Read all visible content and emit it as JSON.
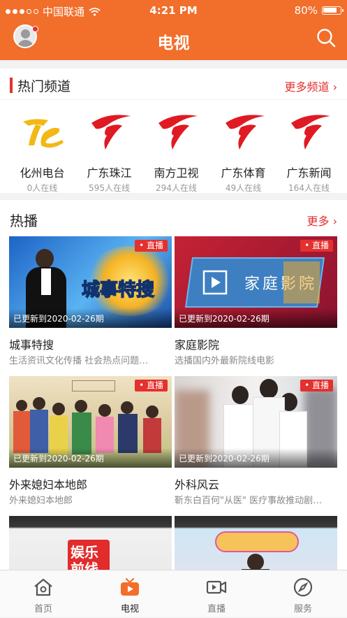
{
  "status_bar": {
    "carrier": "中国联通",
    "time": "4:21 PM",
    "battery": "80%"
  },
  "header": {
    "title": "电视"
  },
  "hot_channels": {
    "title": "热门频道",
    "more": "更多频道",
    "items": [
      {
        "name": "化州电台",
        "online": "0人在线",
        "logo": "huazhou-logo"
      },
      {
        "name": "广东珠江",
        "online": "595人在线",
        "logo": "guangdong-logo"
      },
      {
        "name": "南方卫视",
        "online": "294人在线",
        "logo": "guangdong-logo"
      },
      {
        "name": "广东体育",
        "online": "49人在线",
        "logo": "guangdong-logo"
      },
      {
        "name": "广东新闻",
        "online": "164人在线",
        "logo": "guangdong-logo"
      }
    ]
  },
  "hot_play": {
    "title": "热播",
    "more": "更多",
    "items": [
      {
        "title": "城事特搜",
        "desc": "生活资讯文化传播 社会热点问题…",
        "updated": "已更新到2020-02-26期",
        "live": "直播",
        "thumb_text": "城事特搜"
      },
      {
        "title": "家庭影院",
        "desc": "选播国内外最新院线电影",
        "updated": "已更新到2020-02-26期",
        "live": "直播",
        "thumb_text": "家庭影院"
      },
      {
        "title": "外来媳妇本地郎",
        "desc": "外来媳妇本地郎",
        "updated": "已更新到2020-02-26期",
        "live": "直播",
        "thumb_text": ""
      },
      {
        "title": "外科风云",
        "desc": "靳东白百何\"从医\" 医疗事故推动剧…",
        "updated": "已更新到2020-02-26期",
        "live": "直播",
        "thumb_text": ""
      },
      {
        "title": "",
        "desc": "",
        "updated": "",
        "live": "",
        "thumb_text": "娱乐前线"
      },
      {
        "title": "",
        "desc": "",
        "updated": "",
        "live": "",
        "thumb_text": ""
      }
    ]
  },
  "tab_bar": {
    "items": [
      {
        "label": "首页",
        "icon": "home-icon"
      },
      {
        "label": "电视",
        "icon": "tv-icon"
      },
      {
        "label": "直播",
        "icon": "video-camera-icon"
      },
      {
        "label": "服务",
        "icon": "compass-icon"
      }
    ]
  },
  "colors": {
    "brand": "#f26e2b",
    "accent": "#e4302e"
  }
}
